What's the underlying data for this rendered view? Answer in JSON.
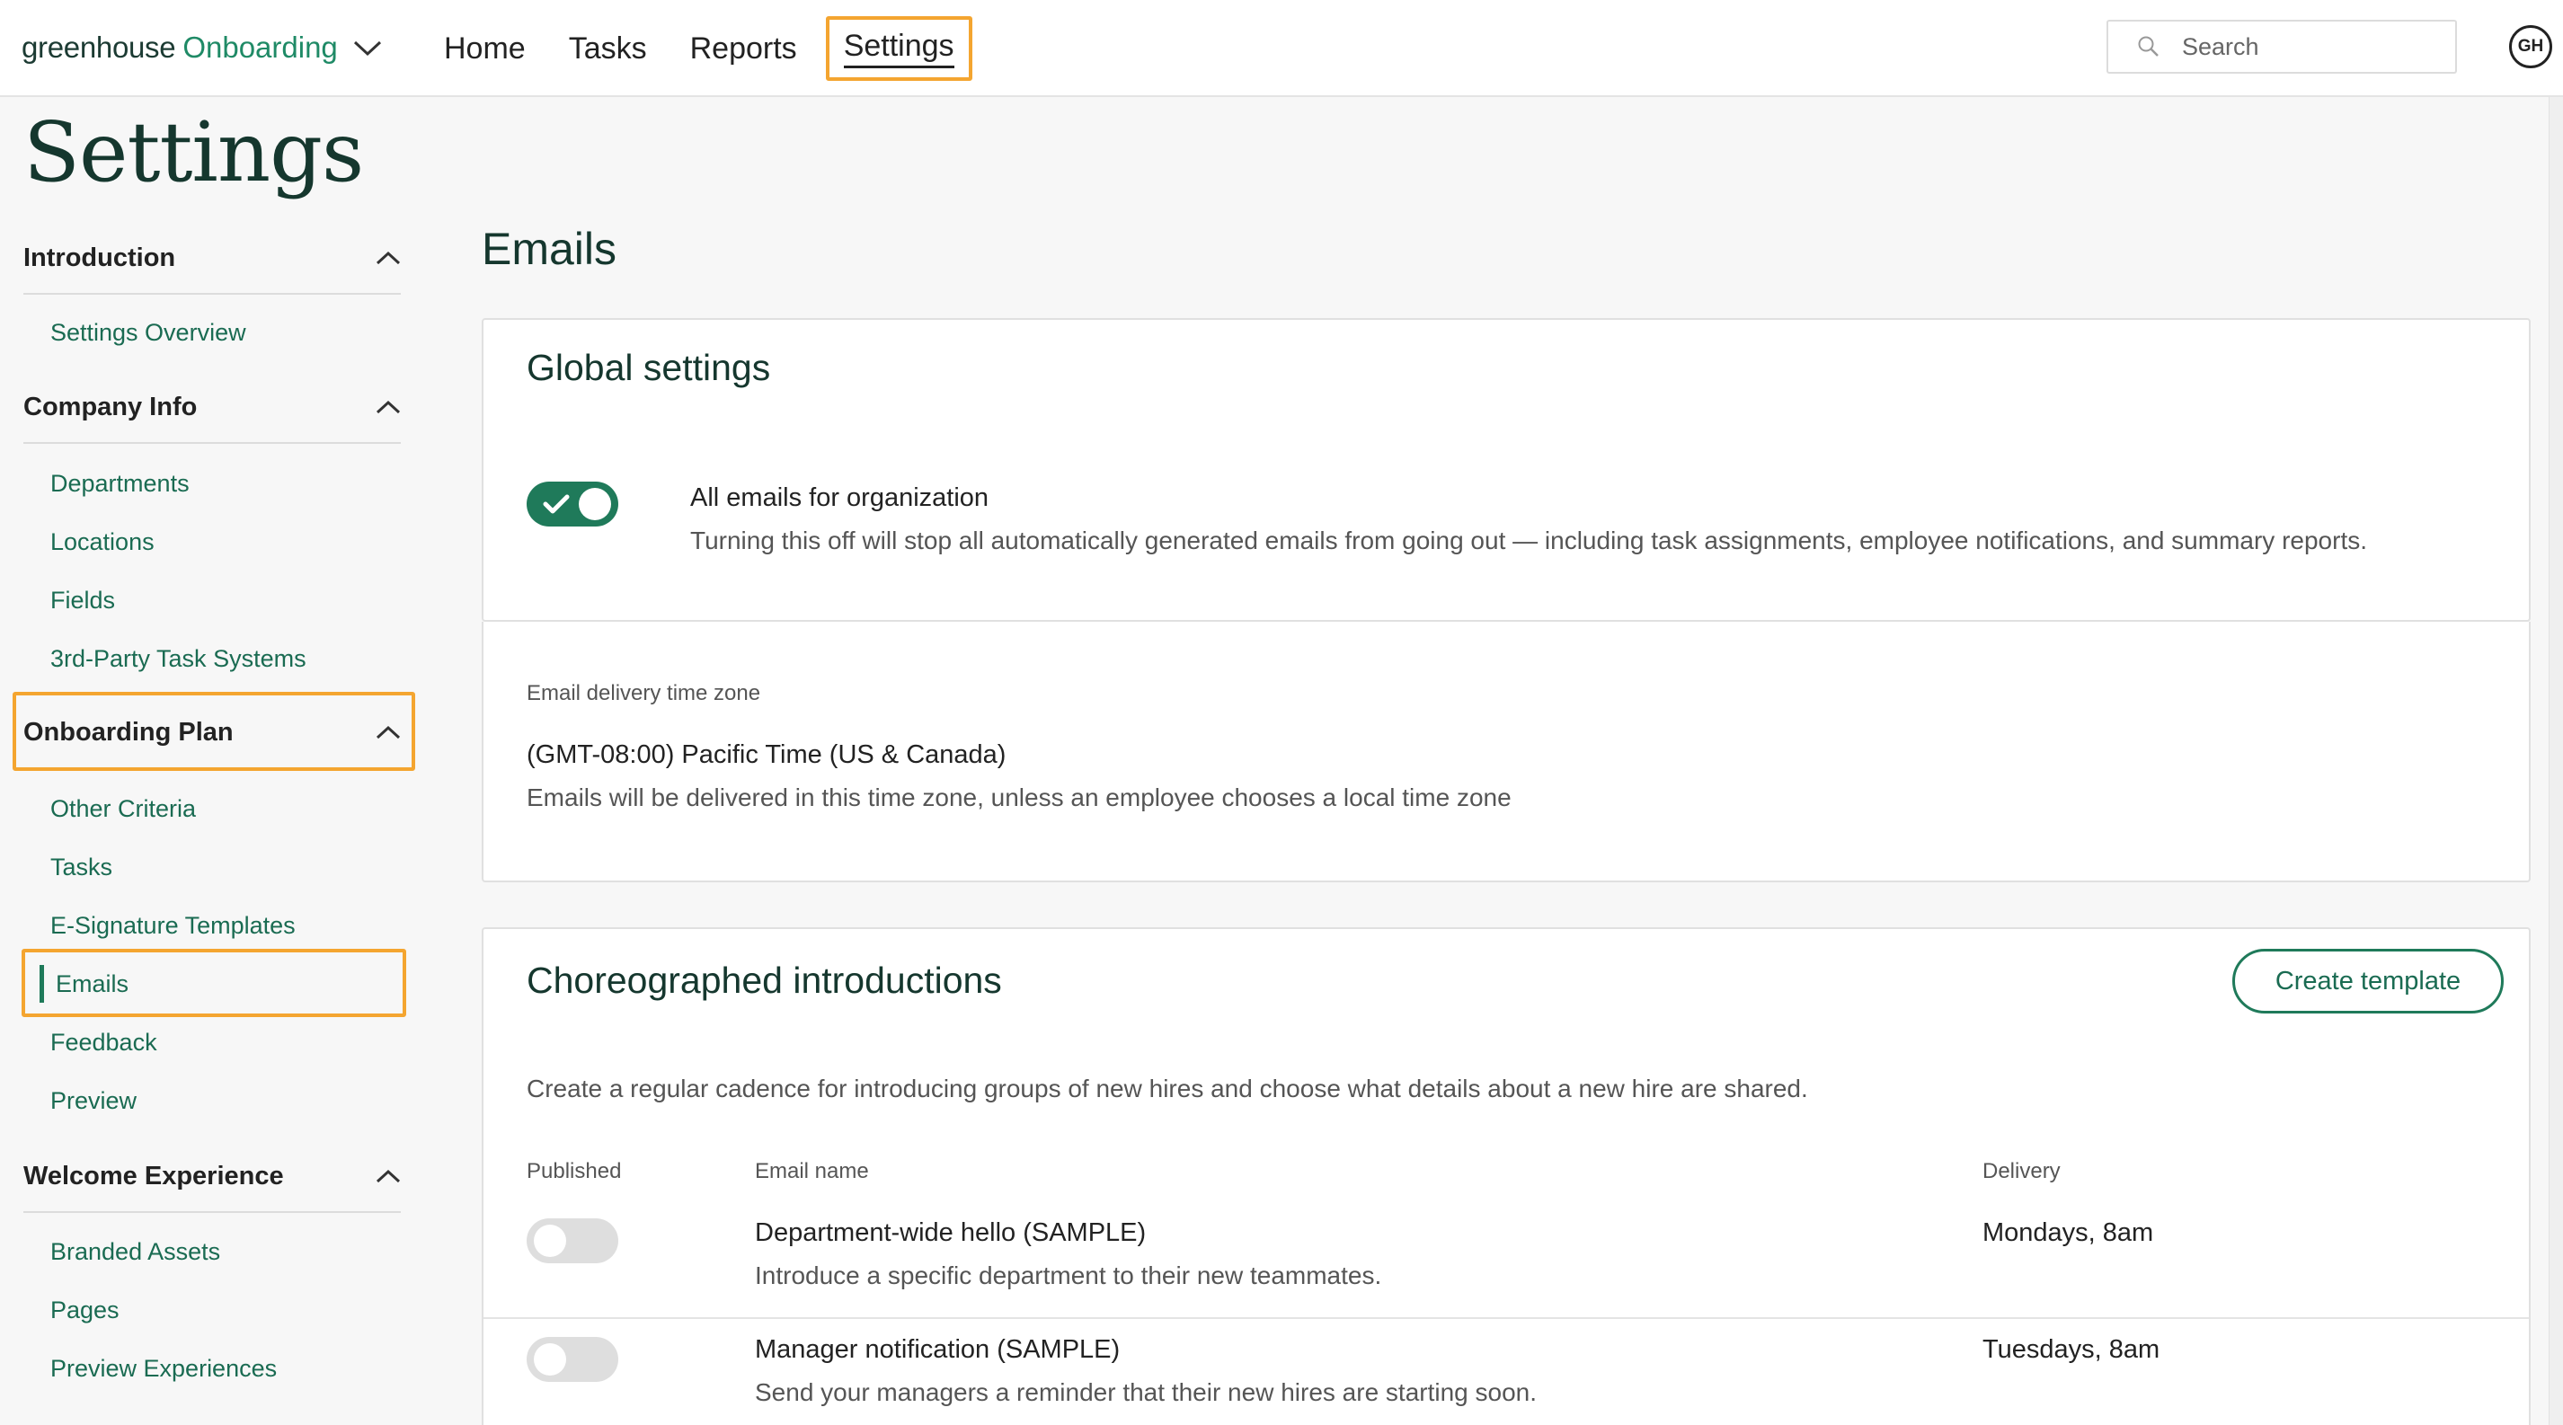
{
  "app": {
    "logo_word": "greenhouse",
    "logo_product": "Onboarding"
  },
  "nav": {
    "items": [
      {
        "label": "Home"
      },
      {
        "label": "Tasks"
      },
      {
        "label": "Reports"
      },
      {
        "label": "Settings",
        "active": true
      }
    ]
  },
  "search": {
    "placeholder": "Search"
  },
  "user": {
    "initials": "GH"
  },
  "page": {
    "title": "Settings"
  },
  "sidebar": {
    "sections": [
      {
        "label": "Introduction",
        "links": [
          "Settings Overview"
        ]
      },
      {
        "label": "Company Info",
        "links": [
          "Departments",
          "Locations",
          "Fields",
          "3rd-Party Task Systems"
        ]
      },
      {
        "label": "Onboarding Plan",
        "links": [
          "Other Criteria",
          "Tasks",
          "E-Signature Templates",
          "Emails",
          "Feedback",
          "Preview"
        ],
        "active_link": "Emails"
      },
      {
        "label": "Welcome Experience",
        "links": [
          "Branded Assets",
          "Pages",
          "Preview Experiences"
        ]
      }
    ]
  },
  "main": {
    "title": "Emails",
    "global_settings": {
      "title": "Global settings",
      "toggle_on": true,
      "toggle_label": "All emails for organization",
      "toggle_desc": "Turning this off will stop all automatically generated emails from going out — including task assignments, employee notifications, and summary reports."
    },
    "timezone": {
      "label": "Email delivery time zone",
      "value": "(GMT-08:00) Pacific Time (US & Canada)",
      "desc": "Emails will be delivered in this time zone, unless an employee chooses a local time zone"
    },
    "intros": {
      "title": "Choreographed introductions",
      "create_button": "Create template",
      "desc": "Create a regular cadence for introducing groups of new hires and choose what details about a new hire are shared.",
      "columns": {
        "published": "Published",
        "name": "Email name",
        "delivery": "Delivery"
      },
      "rows": [
        {
          "published": false,
          "name": "Department-wide hello (SAMPLE)",
          "desc": "Introduce a specific department to their new teammates.",
          "delivery": "Mondays, 8am"
        },
        {
          "published": false,
          "name": "Manager notification (SAMPLE)",
          "desc": "Send your managers a reminder that their new hires are starting soon.",
          "delivery": "Tuesdays, 8am"
        }
      ]
    }
  },
  "colors": {
    "brand_green": "#1f7a5a",
    "link_green": "#1a6b52",
    "highlight": "#f4a530"
  }
}
